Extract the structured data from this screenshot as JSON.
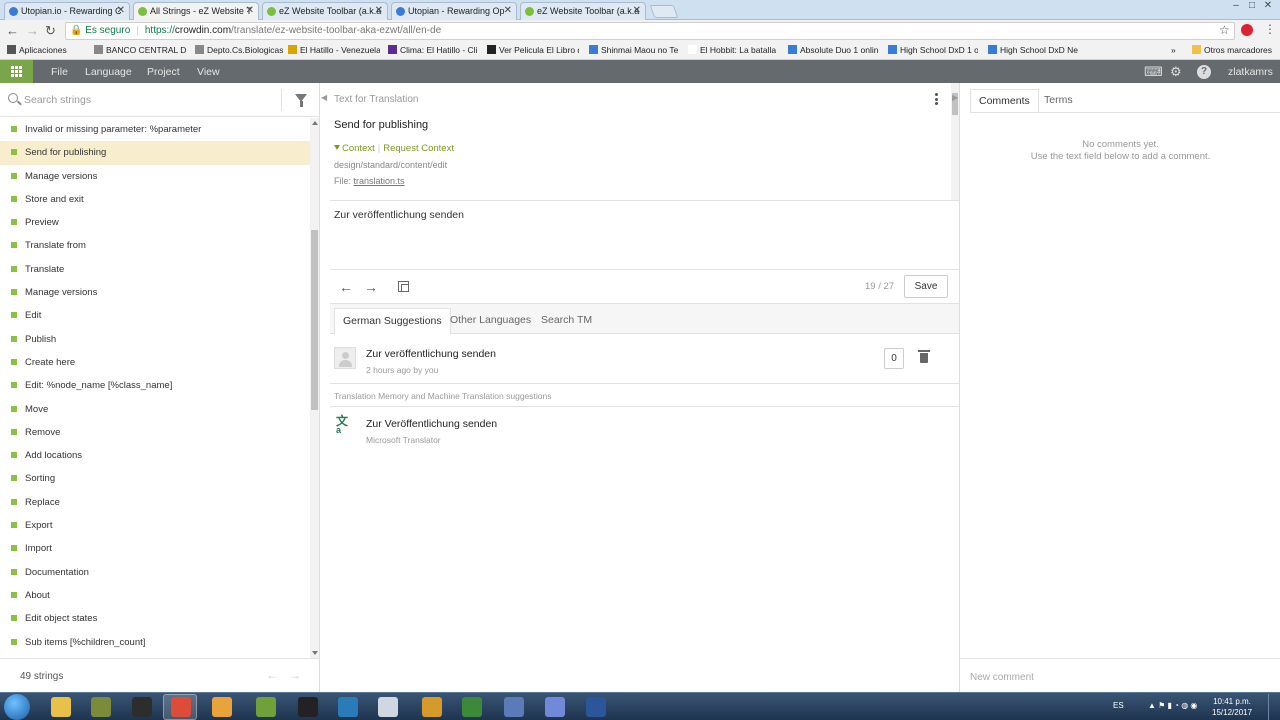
{
  "browser": {
    "tabs": [
      {
        "title": "Utopian.io - Rewarding C",
        "fav": "#3b7bd8"
      },
      {
        "title": "All Strings - eZ Website T",
        "fav": "#7bbf3b",
        "active": true
      },
      {
        "title": "eZ Website Toolbar (a.k.a",
        "fav": "#7bbf3b"
      },
      {
        "title": "Utopian - Rewarding Op",
        "fav": "#3b7bd8"
      },
      {
        "title": "eZ Website Toolbar (a.k.a",
        "fav": "#7bbf3b"
      }
    ],
    "close_glyph": "✕",
    "secure_label": "Es seguro",
    "url_scheme": "https://",
    "url_host": "crowdin.com",
    "url_path": "/translate/ez-website-toolbar-aka-ezwt/all/en-de",
    "bookmarks": [
      {
        "label": "Aplicaciones",
        "color": "#555"
      },
      {
        "label": "BANCO CENTRAL DE",
        "color": "#888"
      },
      {
        "label": "Depto.Cs.Biologicas",
        "color": "#888"
      },
      {
        "label": "El Hatillo - Venezuela",
        "color": "#d9a400"
      },
      {
        "label": "Clima: El Hatillo - Clim",
        "color": "#5b2d91"
      },
      {
        "label": "Ver Pelicula El Libro d",
        "color": "#222"
      },
      {
        "label": "Shinmai Maou no Te",
        "color": "#3b7bd8"
      },
      {
        "label": "El Hobbit: La batalla d",
        "color": "#fff"
      },
      {
        "label": "Absolute Duo 1 onlin",
        "color": "#3b7bd8"
      },
      {
        "label": "High School DxD 1 o",
        "color": "#3b7bd8"
      },
      {
        "label": "High School DxD Ne",
        "color": "#3b7bd8"
      }
    ],
    "more_bookmarks": "»",
    "other_bookmarks": "Otros marcadores"
  },
  "app": {
    "menu": [
      "File",
      "Language",
      "Project",
      "View"
    ],
    "username": "zlatkamrs"
  },
  "left": {
    "search_placeholder": "Search strings",
    "strings": [
      "Invalid or missing parameter: %parameter",
      "Send for publishing",
      "Manage versions",
      "Store and exit",
      "Preview",
      "Translate from",
      "Translate",
      "Manage versions",
      "Edit",
      "Publish",
      "Create here",
      "Edit: %node_name [%class_name]",
      "Move",
      "Remove",
      "Add locations",
      "Sorting",
      "Replace",
      "Export",
      "Import",
      "Documentation",
      "About",
      "Edit object states",
      "Sub items [%children_count]"
    ],
    "active_index": 1,
    "count": "49 strings"
  },
  "editor": {
    "header": "Text for Translation",
    "source_text": "Send for publishing",
    "context_label": "Context",
    "request_context_label": "Request Context",
    "context_path": "design/standard/content/edit",
    "file_label": "File:",
    "file_name": "translation.ts",
    "translation_value": "Zur veröffentlichung senden",
    "progress": "19 / 27",
    "save_label": "Save",
    "tabs": [
      "German Suggestions",
      "Other Languages",
      "Search TM"
    ],
    "suggestion": {
      "text": "Zur veröffentlichung senden",
      "meta": "2 hours ago by you",
      "votes": "0"
    },
    "tm_label": "Translation Memory and Machine Translation suggestions",
    "mt": {
      "text": "Zur Veröffentlichung senden",
      "source": "Microsoft Translator"
    }
  },
  "comments": {
    "tabs": [
      "Comments",
      "Terms"
    ],
    "empty_line1": "No comments yet.",
    "empty_line2": "Use the text field below to add a comment.",
    "new_comment_placeholder": "New comment"
  },
  "taskbar": {
    "icons": [
      "#e8c14a",
      "#7a8b3a",
      "#2d2d2d",
      "#dd4b39",
      "#e8a33a",
      "#6fa03a",
      "#222",
      "#2a7bb8",
      "#cfd8e0",
      "#d49a2a",
      "#3a8a3a",
      "#5a7ab8",
      "#7289da",
      "#2b579a"
    ],
    "lang": "ES",
    "time": "10:41 p.m.",
    "date": "15/12/2017"
  }
}
